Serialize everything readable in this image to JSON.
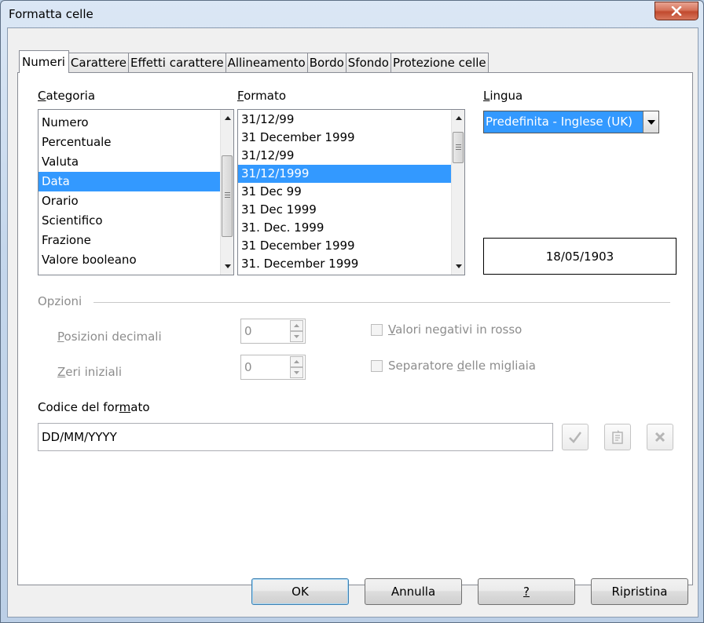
{
  "window": {
    "title": "Formatta celle"
  },
  "tabs": [
    "Numeri",
    "Carattere",
    "Effetti carattere",
    "Allineamento",
    "Bordo",
    "Sfondo",
    "Protezione celle"
  ],
  "category": {
    "label_mnemonic": "C",
    "label_rest": "ategoria",
    "items": [
      "Numero",
      "Percentuale",
      "Valuta",
      "Data",
      "Orario",
      "Scientifico",
      "Frazione",
      "Valore booleano"
    ],
    "selected_index": 3
  },
  "format": {
    "label_mnemonic": "F",
    "label_rest": "ormato",
    "items": [
      "31/12/99",
      "31 December 1999",
      "31/12/99",
      "31/12/1999",
      "31 Dec 99",
      "31 Dec 1999",
      "31. Dec. 1999",
      "31 December 1999",
      "31. December 1999"
    ],
    "selected_index": 3
  },
  "language": {
    "label_mnemonic": "L",
    "label_rest": "ingua",
    "value": "Predefinita - Inglese (UK)"
  },
  "preview": {
    "value": "18/05/1903"
  },
  "options": {
    "title": "Opzioni",
    "decimal_label_mnemonic": "P",
    "decimal_label_rest": "osizioni decimali",
    "decimal_value": "0",
    "leading_label_mnemonic": "Z",
    "leading_label_rest": "eri iniziali",
    "leading_value": "0",
    "neg_red_mnemonic": "V",
    "neg_red_rest": "alori negativi in rosso",
    "thousands_pre": "Separatore ",
    "thousands_mnemonic": "d",
    "thousands_rest": "elle migliaia"
  },
  "format_code": {
    "label_pre": "Codice del for",
    "label_mnemonic": "m",
    "label_rest": "ato",
    "value": "DD/MM/YYYY"
  },
  "buttons": {
    "ok": "OK",
    "cancel": "Annulla",
    "help": "?",
    "reset": "Ripristina"
  }
}
